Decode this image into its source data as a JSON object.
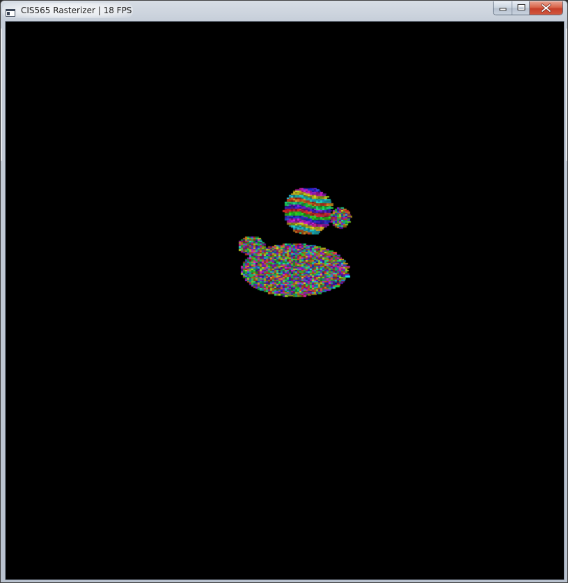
{
  "window": {
    "title": "CIS565 Rasterizer | 18 FPS",
    "buttons": {
      "minimize": "minimize",
      "maximize": "maximize",
      "close": "close"
    }
  },
  "viewport": {
    "background": "#000000",
    "rendered_model": "duck",
    "shading": "per-face random color"
  },
  "colors": {
    "titlebar": "#c6ced9",
    "close_button": "#c6402a",
    "frame_border": "#8a96a6"
  }
}
